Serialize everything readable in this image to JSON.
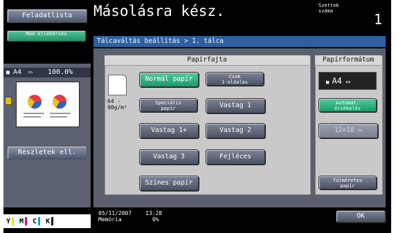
{
  "left": {
    "job_list_button": "Feladatlista",
    "check_job_button": "Mód ellenőrzés",
    "thumb_bar_size": "A4",
    "thumb_bar_zoom": "100.0%",
    "details_button": "Részletek ell.",
    "toner": [
      {
        "letter": "Y",
        "color": "#f2e200"
      },
      {
        "letter": "M",
        "color": "#e0007a"
      },
      {
        "letter": "C",
        "color": "#00a0e0"
      },
      {
        "letter": "K",
        "color": "#111111"
      }
    ]
  },
  "header": {
    "title": "Másolásra kész.",
    "sets_label_line1": "Szettek",
    "sets_label_line2": "száma",
    "sets_count": "1"
  },
  "breadcrumb": "Tálcaváltás beállítás > 1. tálca",
  "paper_type": {
    "heading": "Papírfajta",
    "weight_line1": "64  -",
    "weight_line2": "90g/m²",
    "buttons": {
      "normal": "Normál papír",
      "one_side_line1": "Csak",
      "one_side_line2": "1-oldalas",
      "special_line1": "Speciális",
      "special_line2": "papír",
      "thick1": "Vastag 1",
      "thick1plus": "Vastag 1+",
      "thick2": "Vastag 2",
      "thick3": "Vastag 3",
      "letterhead": "Fejléces",
      "color_paper": "Színes papír"
    }
  },
  "paper_format": {
    "heading": "Papírformátum",
    "current": "A4",
    "auto_line1": "Automat.",
    "auto_line2": "érzékelés",
    "size_12x18": "12×18",
    "oversize_line1": "Túlméretes",
    "oversize_line2": "papír"
  },
  "footer": {
    "date": "05/11/2007",
    "memory_label": "Memória",
    "time": "13:28",
    "memory_value": "0%",
    "ok_button": "OK"
  },
  "colors": {
    "selected": "#22a06e",
    "breadcrumb": "#2e5fa0"
  }
}
